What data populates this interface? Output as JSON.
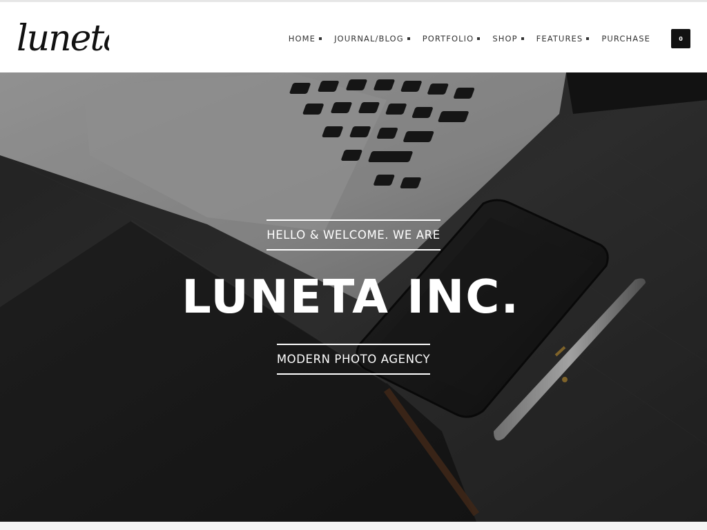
{
  "header": {
    "logo_text": "luneta",
    "nav": [
      {
        "label": "HOME",
        "has_dropdown": true
      },
      {
        "label": "JOURNAL/BLOG",
        "has_dropdown": true
      },
      {
        "label": "PORTFOLIO",
        "has_dropdown": true
      },
      {
        "label": "SHOP",
        "has_dropdown": true
      },
      {
        "label": "FEATURES",
        "has_dropdown": true
      },
      {
        "label": "PURCHASE",
        "has_dropdown": false
      }
    ],
    "cart_count": "0"
  },
  "hero": {
    "welcome": "HELLO & WELCOME. WE ARE",
    "title": "LUNETA INC.",
    "subtitle": "MODERN PHOTO AGENCY"
  },
  "icons": {
    "cart": "cart-icon"
  },
  "colors": {
    "text_dark": "#333333",
    "cart_bg": "#111111",
    "hero_text": "#ffffff"
  }
}
